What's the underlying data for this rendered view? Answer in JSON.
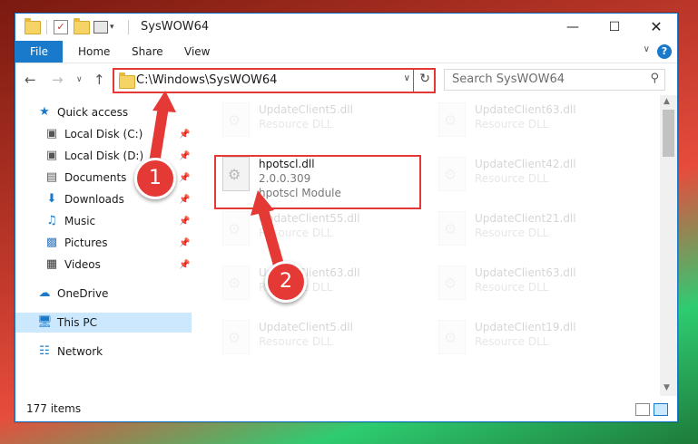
{
  "window": {
    "title": "SysWOW64"
  },
  "ribbon": {
    "file": "File",
    "home": "Home",
    "share": "Share",
    "view": "View"
  },
  "nav": {
    "address": "C:\\Windows\\SysWOW64",
    "search_placeholder": "Search SysWOW64"
  },
  "sidebar": {
    "items": [
      {
        "label": "Quick access",
        "icon": "star-icon"
      },
      {
        "label": "Local Disk (C:)",
        "icon": "drive-icon",
        "pinned": true
      },
      {
        "label": "Local Disk (D:)",
        "icon": "drive-icon",
        "pinned": true
      },
      {
        "label": "Documents",
        "icon": "documents-icon",
        "pinned": true
      },
      {
        "label": "Downloads",
        "icon": "download-icon",
        "pinned": true
      },
      {
        "label": "Music",
        "icon": "music-icon",
        "pinned": true
      },
      {
        "label": "Pictures",
        "icon": "pictures-icon",
        "pinned": true
      },
      {
        "label": "Videos",
        "icon": "videos-icon",
        "pinned": true
      },
      {
        "label": "OneDrive",
        "icon": "cloud-icon"
      },
      {
        "label": "This PC",
        "icon": "computer-icon",
        "selected": true
      },
      {
        "label": "Network",
        "icon": "network-icon"
      }
    ]
  },
  "files": {
    "highlighted": {
      "name": "hpotscl.dll",
      "version": "2.0.0.309",
      "description": "hpotscl Module"
    },
    "left_col": [
      {
        "name": "UpdateClient5.dll",
        "type": "Resource DLL"
      },
      {
        "name": "UpdateClient55.dll",
        "type": "Resource DLL"
      },
      {
        "name": "UpdateClient63.dll",
        "type": "Resource DLL"
      },
      {
        "name": "UpdateClient5.dll",
        "type": "Resource DLL"
      }
    ],
    "right_col": [
      {
        "name": "UpdateClient63.dll",
        "type": "Resource DLL"
      },
      {
        "name": "UpdateClient42.dll",
        "type": "Resource DLL"
      },
      {
        "name": "UpdateClient21.dll",
        "type": "Resource DLL"
      },
      {
        "name": "UpdateClient63.dll",
        "type": "Resource DLL"
      },
      {
        "name": "UpdateClient19.dll",
        "type": "Resource DLL"
      }
    ]
  },
  "status": {
    "count": "177 items"
  },
  "annotations": {
    "step1": "1",
    "step2": "2",
    "color": "#e53935"
  }
}
